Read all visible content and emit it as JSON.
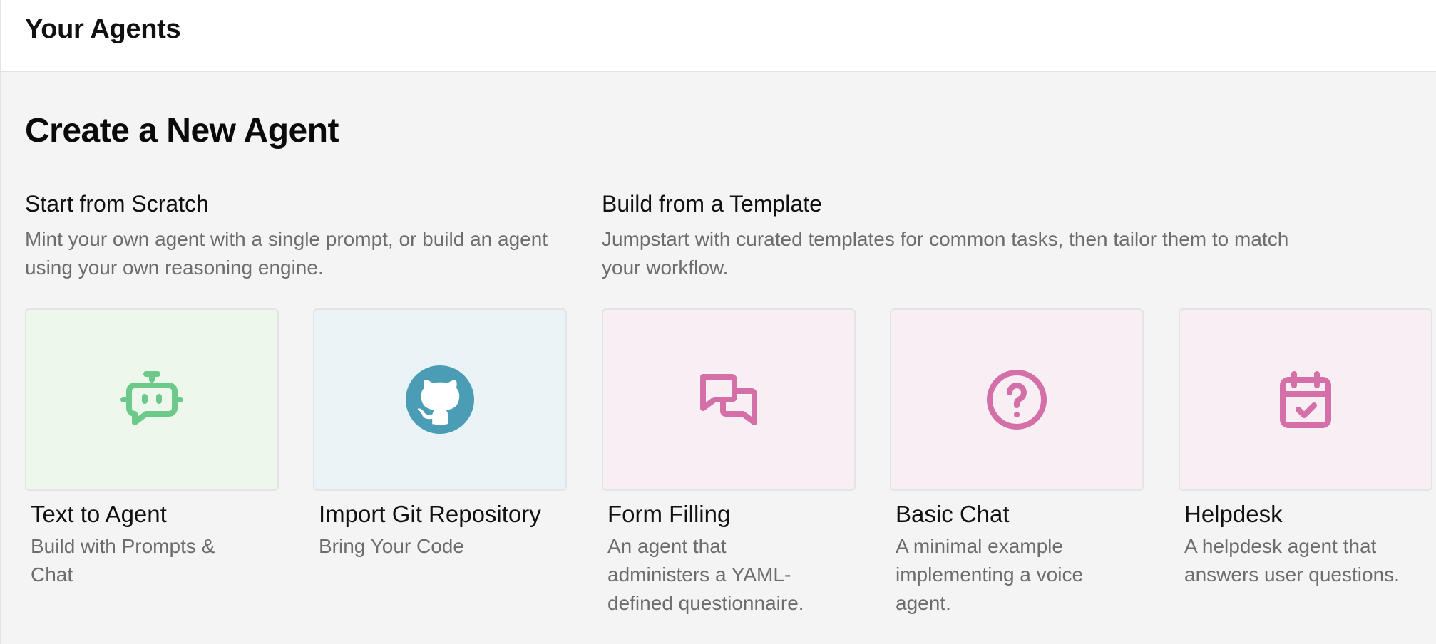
{
  "header": {
    "title": "Your Agents"
  },
  "main": {
    "title": "Create a New Agent",
    "scratch": {
      "heading": "Start from Scratch",
      "description": "Mint your own agent with a single prompt, or build an agent using your own reasoning engine.",
      "cards": [
        {
          "title": "Text to Agent",
          "description": "Build with Prompts & Chat",
          "icon": "robot-chat-icon",
          "bg": "#eef7ec",
          "icon_color": "#6cc98a"
        },
        {
          "title": "Import Git Repository",
          "description": "Bring Your Code",
          "icon": "github-icon",
          "bg": "#eaf3f6",
          "icon_color": "#4b9db5"
        }
      ]
    },
    "template": {
      "heading": "Build from a Template",
      "description": "Jumpstart with curated templates for common tasks, then tailor them to match your workflow.",
      "cards": [
        {
          "title": "Form Filling",
          "description": "An agent that administers a YAML-defined questionnaire.",
          "icon": "chat-bubbles-icon",
          "bg": "#f8eff4",
          "icon_color": "#d46fa8"
        },
        {
          "title": "Basic Chat",
          "description": "A minimal example implementing a voice agent.",
          "icon": "question-circle-icon",
          "bg": "#f8eff4",
          "icon_color": "#d46fa8"
        },
        {
          "title": "Helpdesk",
          "description": "A helpdesk agent that answers user questions.",
          "icon": "calendar-check-icon",
          "bg": "#f8eff4",
          "icon_color": "#d46fa8"
        }
      ]
    }
  }
}
